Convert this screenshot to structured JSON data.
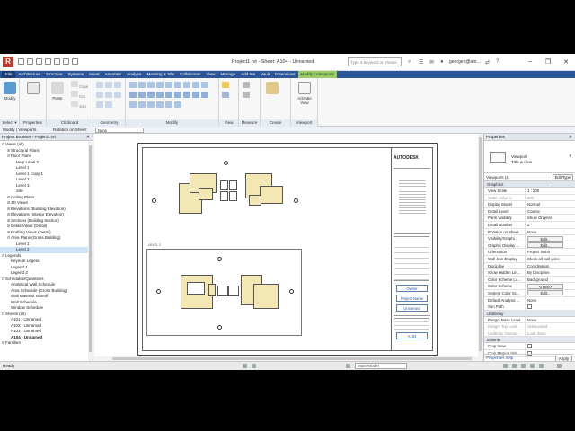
{
  "window": {
    "title": "Project1.rvt - Sheet: A104 - Unnamed",
    "search_placeholder": "Type a keyword or phrase",
    "user": "georgeh@ato…",
    "logo_letter": "R"
  },
  "ribbon": {
    "tabs": [
      "File",
      "Architecture",
      "Structure",
      "Systems",
      "Insert",
      "Annotate",
      "Analyze",
      "Massing & Site",
      "Collaborate",
      "View",
      "Manage",
      "Add-Ins",
      "Vault",
      "Extensions",
      "Modify | Viewports"
    ],
    "active_tab": "Modify | Viewports",
    "panels": {
      "select": "Select ▾",
      "properties": "Properties",
      "clipboard": "Clipboard",
      "geometry": "Geometry",
      "modify": "Modify",
      "view": "View",
      "measure": "Measure",
      "create": "Create",
      "viewport": "Viewport"
    },
    "buttons": {
      "modify": "Modify",
      "paste": "Paste",
      "cope": "Cope",
      "cut": "Cut",
      "join": "Join",
      "activate_view": "Activate View"
    }
  },
  "options_bar": {
    "context": "Modify | Viewports",
    "rotation_label": "Rotation on Sheet:",
    "rotation_value": "None"
  },
  "browser": {
    "title": "Project Browser - Project1.rvt",
    "items": [
      {
        "label": "Views (all)",
        "indent": 0,
        "toggle": "⊟"
      },
      {
        "label": "Structural Plans",
        "indent": 1,
        "toggle": "⊞"
      },
      {
        "label": "Floor Plans",
        "indent": 1,
        "toggle": "⊟"
      },
      {
        "label": "Help Level 2",
        "indent": 2,
        "toggle": ""
      },
      {
        "label": "Level 1",
        "indent": 2,
        "toggle": ""
      },
      {
        "label": "Level 1 Copy 1",
        "indent": 2,
        "toggle": ""
      },
      {
        "label": "Level 2",
        "indent": 2,
        "toggle": ""
      },
      {
        "label": "Level 3",
        "indent": 2,
        "toggle": ""
      },
      {
        "label": "Site",
        "indent": 2,
        "toggle": ""
      },
      {
        "label": "Ceiling Plans",
        "indent": 1,
        "toggle": "⊞"
      },
      {
        "label": "3D Views",
        "indent": 1,
        "toggle": "⊞"
      },
      {
        "label": "Elevations (Building Elevation)",
        "indent": 1,
        "toggle": "⊞"
      },
      {
        "label": "Elevations (Interior Elevation)",
        "indent": 1,
        "toggle": "⊞"
      },
      {
        "label": "Sections (Building Section)",
        "indent": 1,
        "toggle": "⊞"
      },
      {
        "label": "Detail Views (Detail)",
        "indent": 1,
        "toggle": "⊞"
      },
      {
        "label": "Drafting Views (Detail)",
        "indent": 1,
        "toggle": "⊞"
      },
      {
        "label": "Area Plans (Gross Building)",
        "indent": 1,
        "toggle": "⊟"
      },
      {
        "label": "Level 1",
        "indent": 2,
        "toggle": ""
      },
      {
        "label": "Level 2",
        "indent": 2,
        "toggle": "",
        "selected": true
      },
      {
        "label": "Legends",
        "indent": 0,
        "toggle": "⊟"
      },
      {
        "label": "Keynote Legend",
        "indent": 1,
        "toggle": ""
      },
      {
        "label": "Legend 1",
        "indent": 1,
        "toggle": ""
      },
      {
        "label": "Legend 2",
        "indent": 1,
        "toggle": ""
      },
      {
        "label": "Schedules/Quantities",
        "indent": 0,
        "toggle": "⊟"
      },
      {
        "label": "Analytical Wall Schedule",
        "indent": 1,
        "toggle": ""
      },
      {
        "label": "Area Schedule (Gross Building)",
        "indent": 1,
        "toggle": ""
      },
      {
        "label": "Wall Material Takeoff",
        "indent": 1,
        "toggle": ""
      },
      {
        "label": "Wall Schedule",
        "indent": 1,
        "toggle": ""
      },
      {
        "label": "Window Schedule",
        "indent": 1,
        "toggle": ""
      },
      {
        "label": "Sheets (all)",
        "indent": 0,
        "toggle": "⊟"
      },
      {
        "label": "A101 - Unnamed",
        "indent": 1,
        "toggle": ""
      },
      {
        "label": "A102 - Unnamed",
        "indent": 1,
        "toggle": ""
      },
      {
        "label": "A103 - Unnamed",
        "indent": 1,
        "toggle": ""
      },
      {
        "label": "A104 - Unnamed",
        "indent": 1,
        "toggle": "",
        "bold": true
      },
      {
        "label": "Families",
        "indent": 0,
        "toggle": "⊞"
      }
    ]
  },
  "sheet": {
    "logo": "AUTODESK",
    "field_owner": "Owner",
    "field_project": "Project Name",
    "field_unnamed": "Unnamed",
    "field_number": "A104",
    "viewport_label": "LEVEL 2"
  },
  "properties": {
    "title": "Properties",
    "type_name_1": "Viewport",
    "type_name_2": "Title w Line",
    "filter": "Viewports (1)",
    "edit_type": "Edit Type",
    "groups": [
      {
        "name": "Graphics",
        "rows": [
          {
            "name": "View Scale",
            "value": "1 : 200"
          },
          {
            "name": "Scale Value 1:",
            "value": "200",
            "dim": true
          },
          {
            "name": "Display Model",
            "value": "Normal"
          },
          {
            "name": "Detail Level",
            "value": "Coarse"
          },
          {
            "name": "Parts Visibility",
            "value": "Show Original"
          },
          {
            "name": "Detail Number",
            "value": "2"
          },
          {
            "name": "Rotation on Sheet",
            "value": "None"
          },
          {
            "name": "Visibility/Graphi...",
            "value": "Edit...",
            "button": true
          },
          {
            "name": "Graphic Display ...",
            "value": "Edit...",
            "button": true
          },
          {
            "name": "Orientation",
            "value": "Project North"
          },
          {
            "name": "Wall Join Display",
            "value": "Clean all wall joins"
          },
          {
            "name": "Discipline",
            "value": "Coordination"
          },
          {
            "name": "Show Hidden Lin...",
            "value": "By Discipline"
          },
          {
            "name": "Color Scheme Lo...",
            "value": "Background"
          },
          {
            "name": "Color Scheme",
            "value": "<none>",
            "button": true
          },
          {
            "name": "System Color Sc...",
            "value": "Edit...",
            "button": true
          },
          {
            "name": "Default Analysis ...",
            "value": "None"
          },
          {
            "name": "Sun Path",
            "value": "",
            "checkbox": true
          }
        ]
      },
      {
        "name": "Underlay",
        "rows": [
          {
            "name": "Range: Base Level",
            "value": "None"
          },
          {
            "name": "Range: Top Level",
            "value": "Unbounded",
            "dim": true
          },
          {
            "name": "Underlay Orienta...",
            "value": "Look down",
            "dim": true
          }
        ]
      },
      {
        "name": "Extents",
        "rows": [
          {
            "name": "Crop View",
            "value": "",
            "checkbox": true
          },
          {
            "name": "Crop Region Visi...",
            "value": "",
            "checkbox": true
          }
        ]
      }
    ],
    "help_link": "Properties help",
    "apply": "Apply"
  },
  "status": {
    "text": "Ready",
    "model": "Main Model"
  }
}
